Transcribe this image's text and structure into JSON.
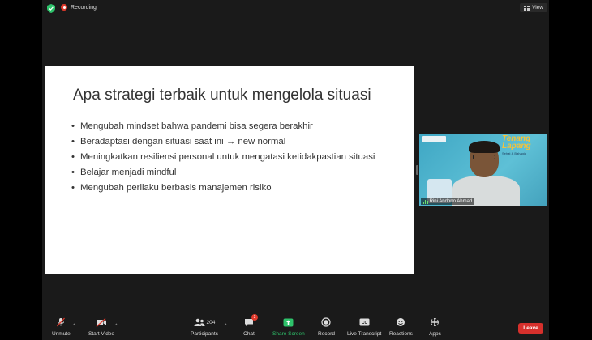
{
  "top_bar": {
    "recording_label": "Recording",
    "view_label": "View"
  },
  "slide": {
    "title": "Apa strategi terbaik untuk mengelola situasi",
    "bullets": [
      "Mengubah mindset bahwa pandemi bisa segera berakhir",
      "Beradaptasi dengan situasi saat ini → new normal",
      "Meningkatkan resiliensi personal untuk mengatasi ketidakpastian situasi",
      "Belajar menjadi mindful",
      "Mengubah perilaku berbasis manajemen risiko"
    ]
  },
  "video": {
    "participant_name": "Rini Andono Ahmad",
    "logo_text": "Tenang Lapang"
  },
  "toolbar": {
    "unmute": "Unmute",
    "start_video": "Start Video",
    "participants": "Participants",
    "participants_count": "204",
    "chat": "Chat",
    "chat_badge": "3",
    "share_screen": "Share Screen",
    "record": "Record",
    "live_transcript": "Live Transcript",
    "reactions": "Reactions",
    "apps": "Apps",
    "leave": "Leave"
  },
  "colors": {
    "share_green": "#2ec36b",
    "leave_red": "#d6302c",
    "recording_red": "#e0392b",
    "shield_green": "#2ec36b"
  }
}
